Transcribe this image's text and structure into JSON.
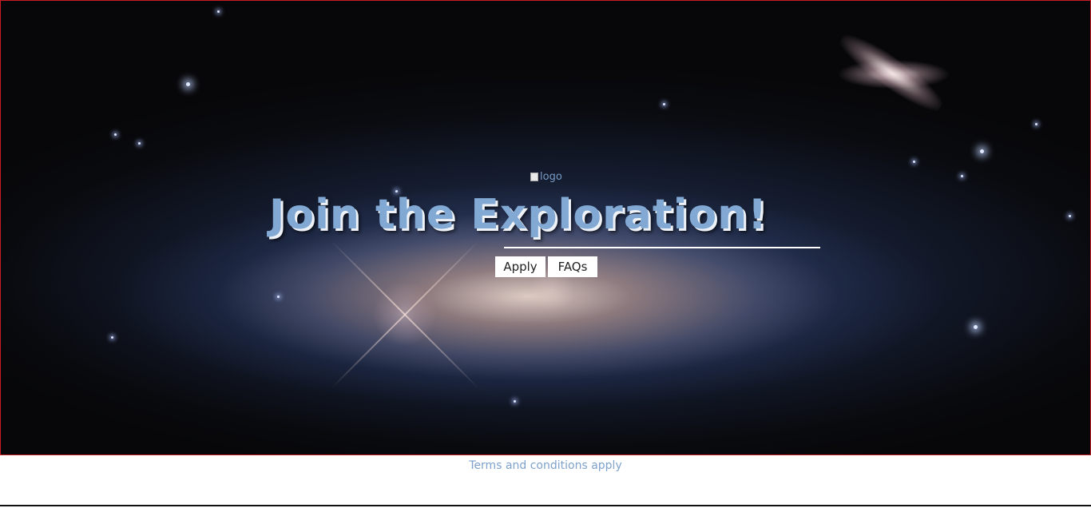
{
  "hero": {
    "logo_alt": "logo",
    "headline": "Join the Exploration!",
    "buttons": {
      "apply_label": "Apply",
      "faqs_label": "FAQs"
    }
  },
  "footer": {
    "terms_text": "Terms and conditions apply"
  },
  "colors": {
    "accent": "#82a8d4",
    "hero_border": "#c81d25",
    "footer_text": "#7ea2cc"
  }
}
